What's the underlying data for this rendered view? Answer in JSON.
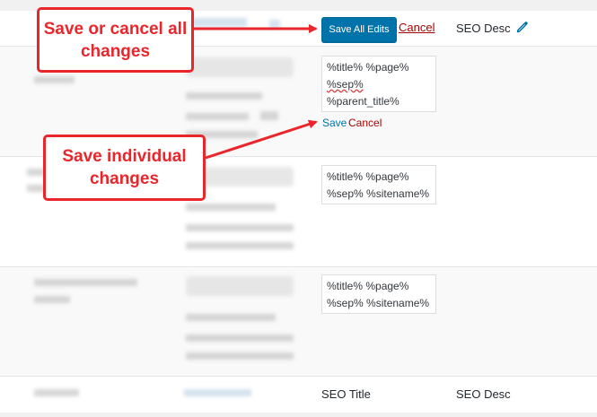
{
  "header": {
    "save_all_label": "Save All Edits",
    "cancel_label": "Cancel",
    "seo_desc_label": "SEO Desc"
  },
  "rows": [
    {
      "textarea_lines": [
        "%title% %page%",
        "%sep%",
        "%parent_title%"
      ],
      "save_label": "Save",
      "cancel_label": "Cancel"
    },
    {
      "textarea_lines": [
        "%title% %page%",
        "%sep% %sitename%"
      ]
    },
    {
      "textarea_lines": [
        "%title% %page%",
        "%sep% %sitename%"
      ]
    }
  ],
  "footer": {
    "seo_title_label": "SEO Title",
    "seo_desc_label": "SEO Desc"
  },
  "annotations": {
    "top": "Save or cancel all changes",
    "middle": "Save individual changes"
  },
  "colors": {
    "annotation_red": "#e8262b",
    "button_blue": "#0073aa",
    "cancel_red": "#a00",
    "link_blue": "#0073aa"
  }
}
